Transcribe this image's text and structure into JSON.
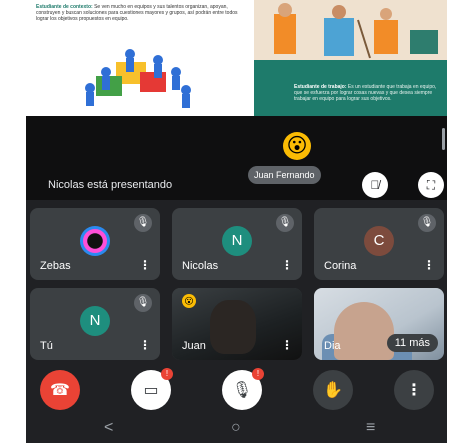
{
  "slide": {
    "left_title": "Estudiante de contexto:",
    "left_text": "Se ven mucho en equipos y sus talentos organizan, apoyan, construyen y buscan soluciones para cuestiones mayores y grupos, así podrán entre todos lograr los objetivos propuestos en equipo.",
    "right_title": "Estudiante de trabajo:",
    "right_text": "Es un estudiante que trabaja en equipo, que se esfuerza por lograr cosas nuevas y que desea siempre trabajar en equipo para lograr sus objetivos."
  },
  "presenting_text": "Nicolas está presentando",
  "tooltip_name": "Juan Fernando",
  "reaction_emoji": "😮",
  "icons": {
    "muted": "🎙̸",
    "fullscreen": "⛶",
    "end_call": "☎",
    "camera_off": "▭",
    "mic_off": "🎙",
    "hand": "✋",
    "more": "⋮",
    "back": "<",
    "home": "○",
    "recent": "≡"
  },
  "tiles": [
    {
      "name": "Zebas",
      "initial": ""
    },
    {
      "name": "Nicolas",
      "initial": "N"
    },
    {
      "name": "Corina",
      "initial": "C"
    },
    {
      "name": "Tú",
      "initial": "N"
    },
    {
      "name": "Juan",
      "initial": ""
    },
    {
      "name": "Dia",
      "initial": ""
    }
  ],
  "more_count": "11 más",
  "controls": {
    "camera_badge": "!",
    "mic_badge": "!"
  }
}
